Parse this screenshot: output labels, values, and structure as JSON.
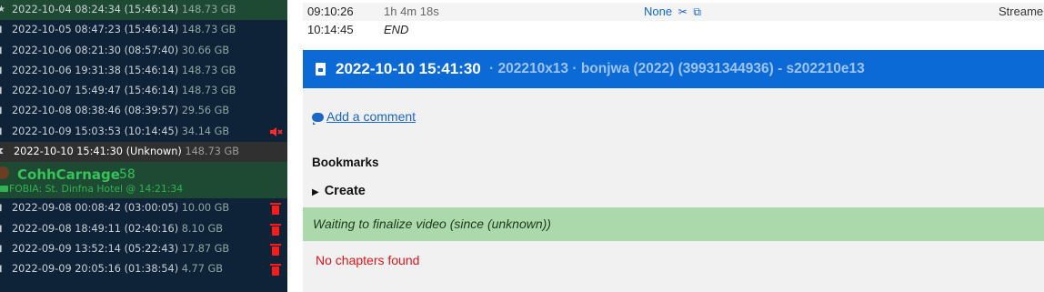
{
  "colors": {
    "sidebar_bg": "#0f2338",
    "sidebar_green": "#1e4a33",
    "accent_blue": "#0b6ad6",
    "notice_bg": "#acd9ac",
    "danger": "#ff1a1a",
    "channel_green": "#35c35a"
  },
  "sidebar": {
    "top_videos": [
      {
        "date": "2022-10-04 08:24:34",
        "duration": "(15:46:14)",
        "size": "148.73 GB",
        "icon": "star-icon"
      },
      {
        "date": "2022-10-05 08:47:23",
        "duration": "(15:46:14)",
        "size": "148.73 GB",
        "icon": "film-icon"
      },
      {
        "date": "2022-10-06 08:21:30",
        "duration": "(08:57:40)",
        "size": "30.66 GB",
        "icon": "film-icon"
      },
      {
        "date": "2022-10-06 19:31:38",
        "duration": "(15:46:14)",
        "size": "148.73 GB",
        "icon": "film-icon"
      },
      {
        "date": "2022-10-07 15:49:47",
        "duration": "(15:46:14)",
        "size": "148.73 GB",
        "icon": "film-icon"
      },
      {
        "date": "2022-10-08 08:38:46",
        "duration": "(08:39:57)",
        "size": "29.56 GB",
        "icon": "film-icon"
      },
      {
        "date": "2022-10-09 15:03:53",
        "duration": "(10:14:45)",
        "size": "34.14 GB",
        "icon": "film-icon"
      }
    ],
    "current_video": {
      "date": "2022-10-10 15:41:30",
      "duration": "(Unknown)",
      "size": "148.73 GB",
      "icon": "hourglass-icon"
    },
    "channel": {
      "name": "CohhCarnage",
      "count": "58",
      "status": "FOBIA: St. Dinfna Hotel @ 14:21:34"
    },
    "channel_videos": [
      {
        "date": "2022-09-08 00:08:42",
        "duration": "(03:00:05)",
        "size": "10.00 GB",
        "icon": "film-icon"
      },
      {
        "date": "2022-09-08 18:49:11",
        "duration": "(02:40:16)",
        "size": "8.10 GB",
        "icon": "film-icon"
      },
      {
        "date": "2022-09-09 13:52:14",
        "duration": "(05:22:43)",
        "size": "17.87 GB",
        "icon": "film-icon"
      },
      {
        "date": "2022-09-09 20:05:16",
        "duration": "(01:38:54)",
        "size": "4.77 GB",
        "icon": "film-icon"
      }
    ]
  },
  "chapters": {
    "row1": {
      "time": "09:10:26",
      "duration": "1h 4m 18s",
      "game": "None",
      "streamed": "Streame"
    },
    "row2": {
      "time": "10:14:45",
      "end_label": "END"
    }
  },
  "video": {
    "date": "2022-10-10 15:41:30",
    "info": "· 202210x13 · bonjwa (2022) (39931344936) - s202210e13",
    "comment_link": "Add a comment",
    "bookmarks_title": "Bookmarks",
    "bookmarks_create": "Create",
    "notice": "Waiting to finalize video (since (unknown))",
    "no_chapters": "No chapters found"
  }
}
